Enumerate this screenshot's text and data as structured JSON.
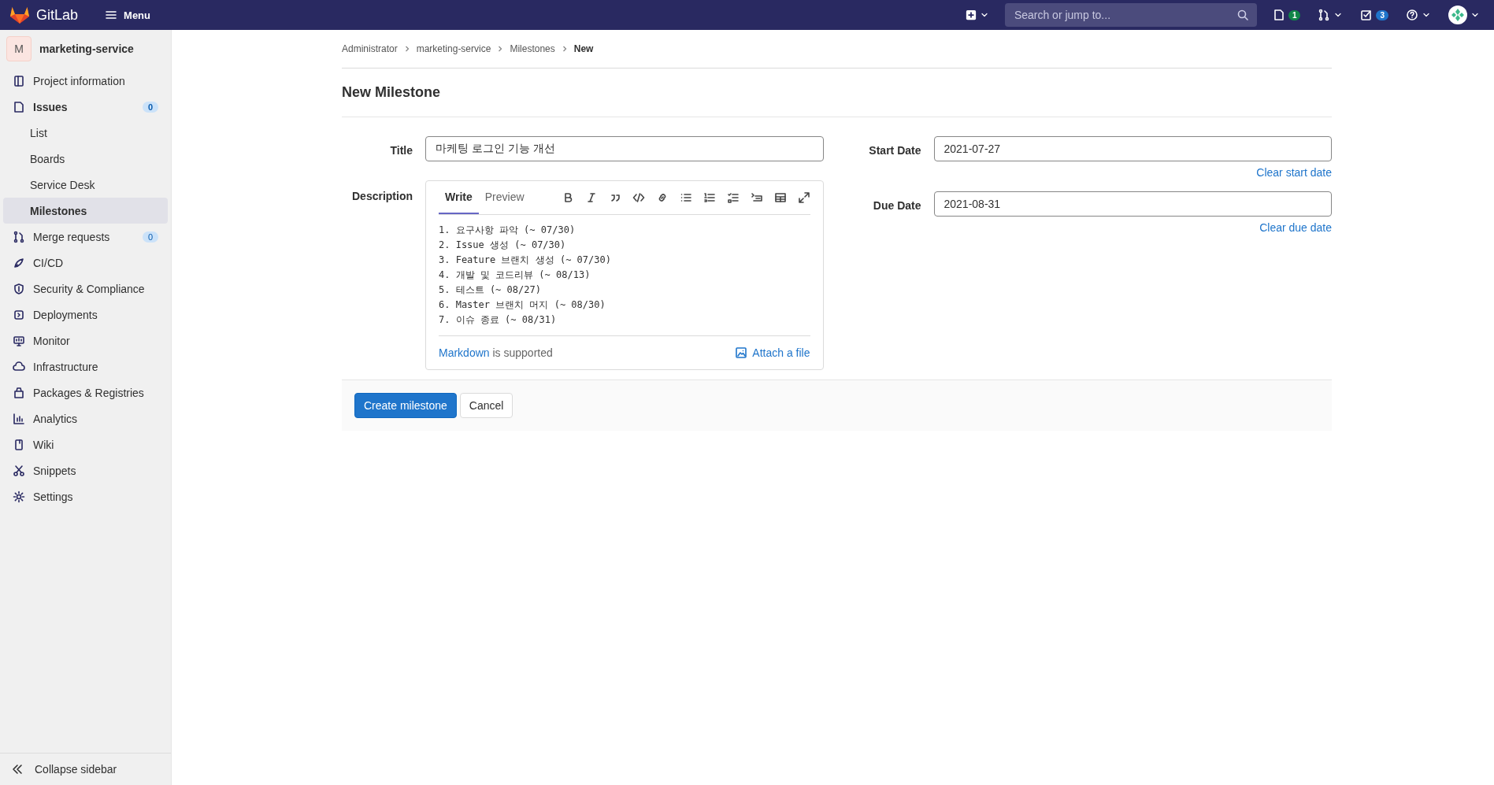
{
  "topbar": {
    "brand": "GitLab",
    "menu": "Menu",
    "search": {
      "placeholder": "Search or jump to..."
    },
    "issues_count": "1",
    "todos_count": "3"
  },
  "sidebar": {
    "project": {
      "avatar": "M",
      "name": "marketing-service"
    },
    "items": [
      {
        "label": "Project information",
        "selected": false
      },
      {
        "label": "Issues",
        "selected": false,
        "badge": "0",
        "expanded": true,
        "children": [
          {
            "label": "List",
            "selected": false
          },
          {
            "label": "Boards",
            "selected": false
          },
          {
            "label": "Service Desk",
            "selected": false
          },
          {
            "label": "Milestones",
            "selected": true
          }
        ]
      },
      {
        "label": "Merge requests",
        "selected": false,
        "badge": "0"
      },
      {
        "label": "CI/CD",
        "selected": false
      },
      {
        "label": "Security & Compliance",
        "selected": false
      },
      {
        "label": "Deployments",
        "selected": false
      },
      {
        "label": "Monitor",
        "selected": false
      },
      {
        "label": "Infrastructure",
        "selected": false
      },
      {
        "label": "Packages & Registries",
        "selected": false
      },
      {
        "label": "Analytics",
        "selected": false
      },
      {
        "label": "Wiki",
        "selected": false
      },
      {
        "label": "Snippets",
        "selected": false
      },
      {
        "label": "Settings",
        "selected": false
      }
    ],
    "collapse": "Collapse sidebar"
  },
  "breadcrumbs": [
    "Administrator",
    "marketing-service",
    "Milestones",
    "New"
  ],
  "page_title": "New Milestone",
  "form": {
    "title_label": "Title",
    "title_value": "마케팅 로그인 기능 개선",
    "description_label": "Description",
    "tabs": [
      {
        "label": "Write",
        "selected": true
      },
      {
        "label": "Preview",
        "selected": false
      }
    ],
    "description_value": "1. 요구사항 파악 (~ 07/30)\n2. Issue 생성 (~ 07/30)\n3. Feature 브랜치 생성 (~ 07/30)\n4. 개발 및 코드리뷰 (~ 08/13)\n5. 테스트 (~ 08/27)\n6. Master 브랜치 머지 (~ 08/30)\n7. 이슈 종료 (~ 08/31)",
    "markdown_link": "Markdown",
    "markdown_text": "is supported",
    "attach": "Attach a file",
    "start_label": "Start Date",
    "start_value": "2021-07-27",
    "clear_start": "Clear start date",
    "due_label": "Due Date",
    "due_value": "2021-08-31",
    "clear_due": "Clear due date"
  },
  "buttons": {
    "create": "Create milestone",
    "cancel": "Cancel"
  }
}
